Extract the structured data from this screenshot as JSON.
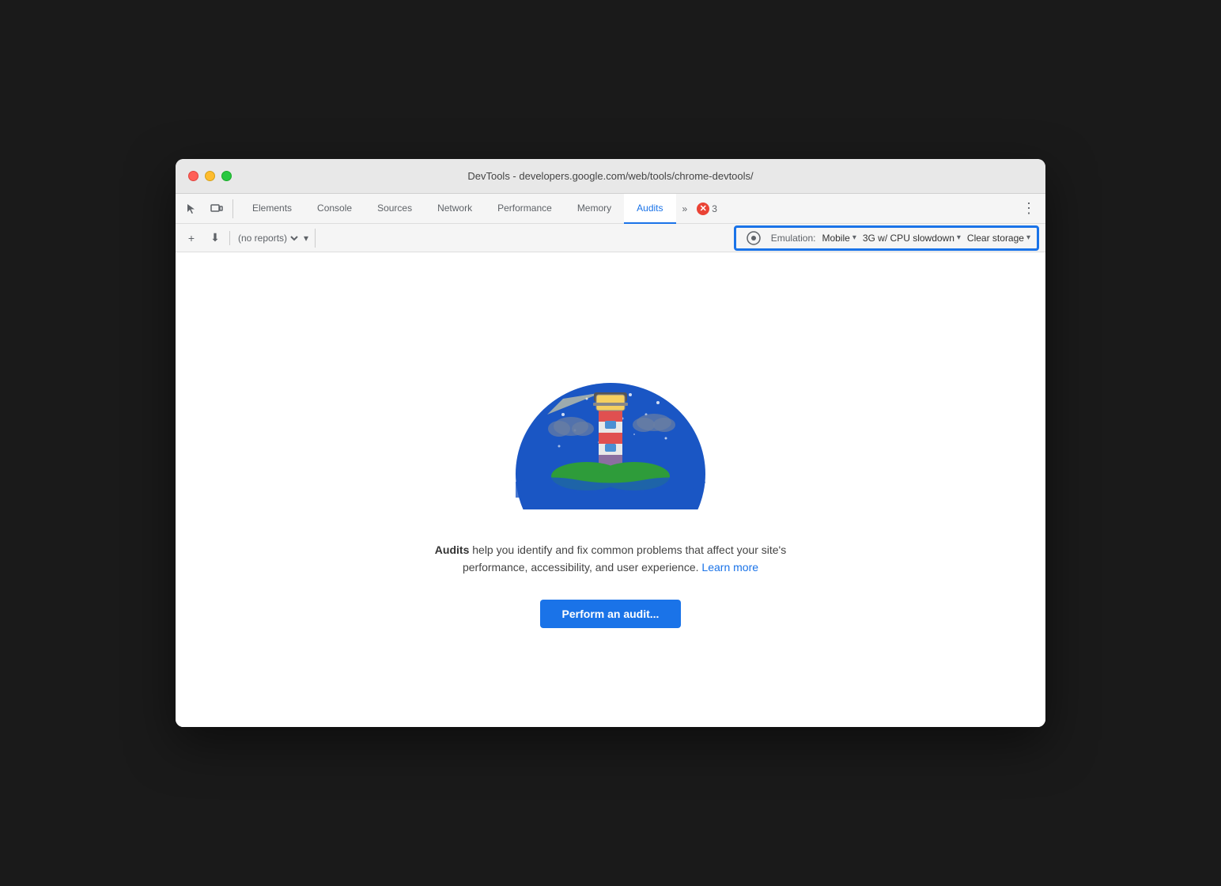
{
  "window": {
    "title": "DevTools - developers.google.com/web/tools/chrome-devtools/"
  },
  "traffic_lights": {
    "close_label": "close",
    "minimize_label": "minimize",
    "maximize_label": "maximize"
  },
  "tabs": [
    {
      "id": "elements",
      "label": "Elements",
      "active": false
    },
    {
      "id": "console",
      "label": "Console",
      "active": false
    },
    {
      "id": "sources",
      "label": "Sources",
      "active": false
    },
    {
      "id": "network",
      "label": "Network",
      "active": false
    },
    {
      "id": "performance",
      "label": "Performance",
      "active": false
    },
    {
      "id": "memory",
      "label": "Memory",
      "active": false
    },
    {
      "id": "audits",
      "label": "Audits",
      "active": true
    }
  ],
  "tab_overflow": {
    "label": "»"
  },
  "error_badge": {
    "count": "3"
  },
  "toolbar": {
    "add_label": "+",
    "download_label": "⬇",
    "reports_placeholder": "(no reports)",
    "emulation_label": "Emulation:",
    "mobile_label": "Mobile",
    "network_label": "3G w/ CPU slowdown",
    "clear_storage_label": "Clear storage"
  },
  "main": {
    "description_bold": "Audits",
    "description_text": " help you identify and fix common problems that affect your site's performance, accessibility, and user experience.",
    "learn_more_label": "Learn more",
    "perform_audit_label": "Perform an audit..."
  },
  "colors": {
    "accent_blue": "#1a73e8",
    "highlight_border": "#1a73e8"
  }
}
